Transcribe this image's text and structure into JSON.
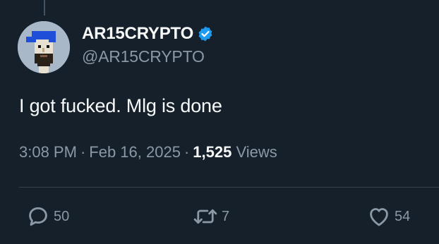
{
  "tweet": {
    "author": {
      "display_name": "AR15CRYPTO",
      "handle": "@AR15CRYPTO",
      "verified": true,
      "verified_color": "#1d9bf0"
    },
    "text": "I got fucked. Mlg is done",
    "meta": {
      "time": "3:08 PM",
      "separator": "·",
      "date": "Feb 16, 2025",
      "views_count": "1,525",
      "views_label": "Views"
    },
    "actions": {
      "reply": {
        "icon": "reply-bubble-icon",
        "count": "50"
      },
      "retweet": {
        "icon": "retweet-arrows-icon",
        "count": "7"
      },
      "like": {
        "icon": "heart-outline-icon",
        "count": "54"
      }
    }
  },
  "colors": {
    "background": "#15202b",
    "text_primary": "#f7f9f9",
    "text_secondary": "#8b98a5",
    "divider": "#38444d"
  }
}
